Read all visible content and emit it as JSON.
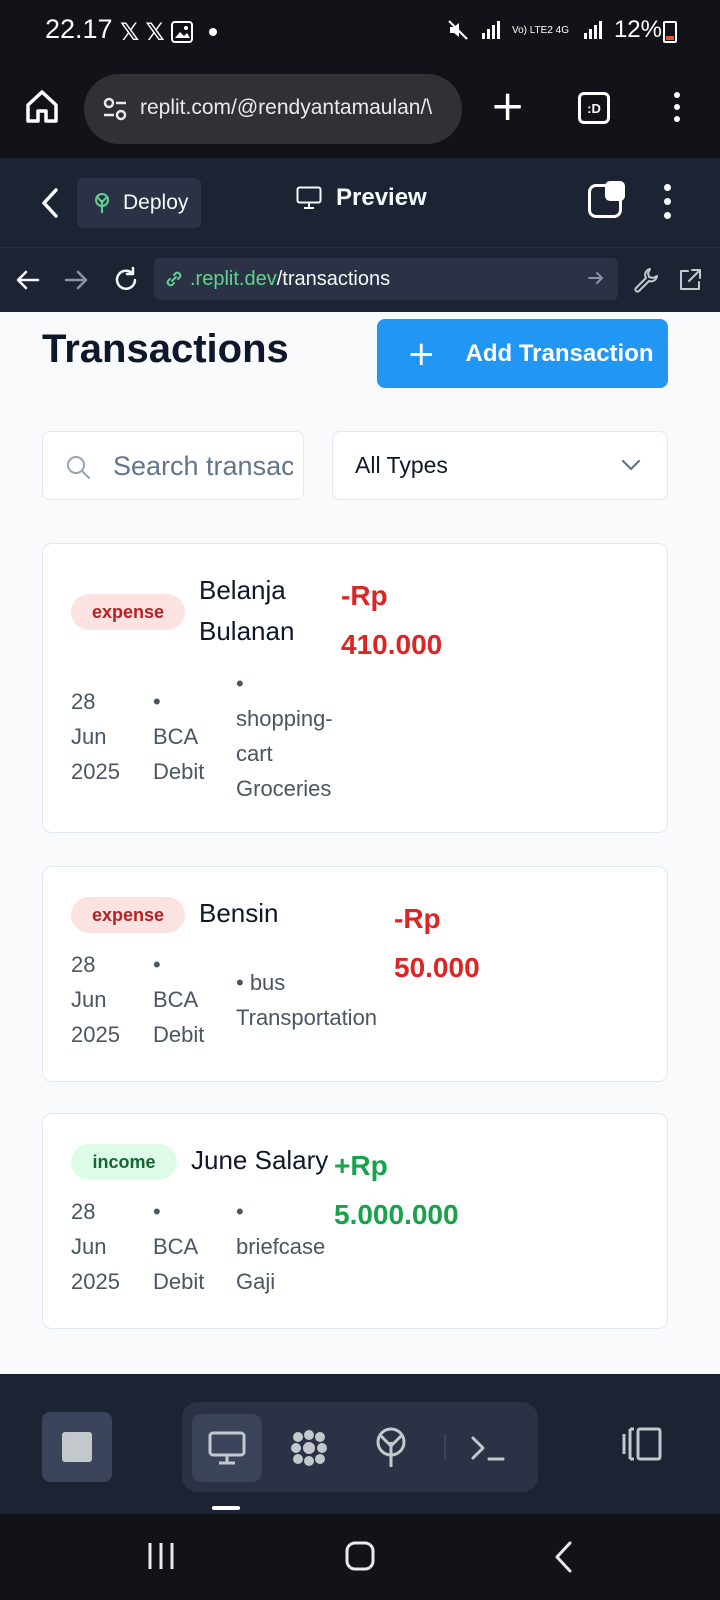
{
  "status_bar": {
    "time": "22.17",
    "notification_icons": [
      "x-logo-icon",
      "x-logo-icon",
      "image-icon"
    ],
    "network_label": "Vo) LTE2 4G",
    "battery": "12%"
  },
  "browser": {
    "url": "replit.com/@rendyantamaulan/\\",
    "tabs_label": ":D"
  },
  "replit_header": {
    "deploy_label": "Deploy",
    "preview_label": "Preview"
  },
  "webview": {
    "url_domain": ".replit.dev",
    "url_path": "/transactions"
  },
  "page": {
    "title": "Transactions",
    "add_button_label": "Add Transaction",
    "search_placeholder": "Search transactions...",
    "type_filter_value": "All Types"
  },
  "transactions": [
    {
      "type": "expense",
      "name_lines": [
        "Belanja",
        "Bulanan"
      ],
      "amount_lines": [
        "-Rp",
        "410.000"
      ],
      "date_lines": [
        "28",
        "Jun",
        "2025"
      ],
      "account_lines": [
        "•",
        "BCA",
        "Debit"
      ],
      "category_lines": [
        "•",
        "shopping-",
        "cart",
        "Groceries"
      ]
    },
    {
      "type": "expense",
      "name_lines": [
        "Bensin"
      ],
      "amount_lines": [
        "-Rp",
        "50.000"
      ],
      "date_lines": [
        "28",
        "Jun",
        "2025"
      ],
      "account_lines": [
        "•",
        "BCA",
        "Debit"
      ],
      "category_lines": [
        "• bus",
        "Transportation"
      ]
    },
    {
      "type": "income",
      "name_lines": [
        "June Salary"
      ],
      "amount_lines": [
        "+Rp",
        "5.000.000"
      ],
      "date_lines": [
        "28",
        "Jun",
        "2025"
      ],
      "account_lines": [
        "•",
        "BCA",
        "Debit"
      ],
      "category_lines": [
        "•",
        "briefcase",
        "Gaji"
      ]
    }
  ],
  "colors": {
    "primary": "#2196f3",
    "expense": "#dc2626",
    "income": "#16a34a"
  }
}
